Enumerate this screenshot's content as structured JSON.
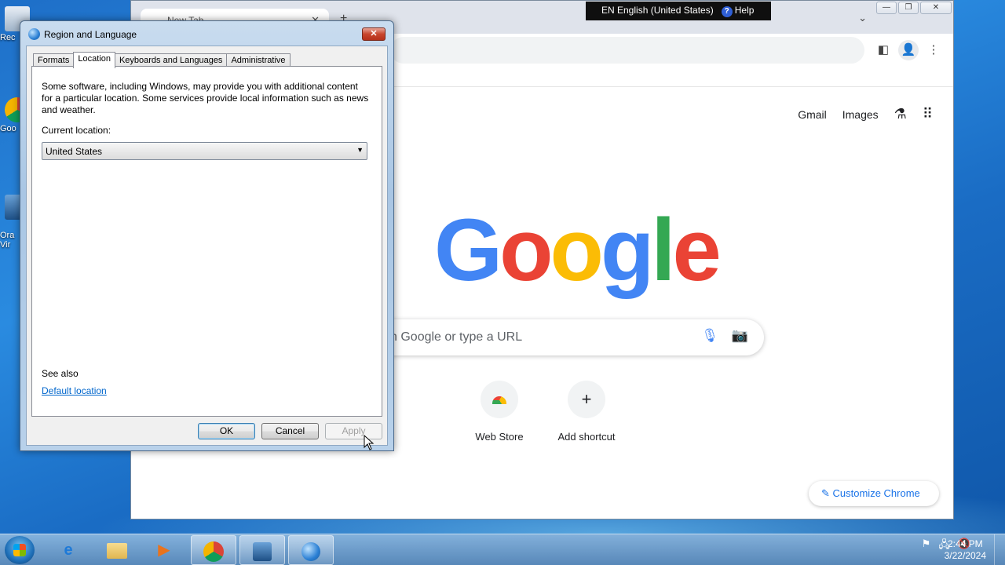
{
  "desktop": {
    "icons": [
      {
        "label": "Rec",
        "icon": "recycle-bin-icon"
      },
      {
        "label": "Goo",
        "icon": "chrome-icon"
      },
      {
        "label": "Ora\nVir",
        "icon": "virtualbox-icon"
      }
    ]
  },
  "language_bar": {
    "language": "EN English (United States)",
    "help": "Help"
  },
  "chrome": {
    "tab_title": "New Tab",
    "omnibox_placeholder": "",
    "links": {
      "gmail": "Gmail",
      "images": "Images"
    },
    "logo": "Google",
    "search_placeholder": "Search Google or type a URL",
    "search_visible_text": "h Google or type a URL",
    "shortcuts": [
      {
        "label": "Web Store"
      },
      {
        "label": "Add shortcut",
        "glyph": "+"
      }
    ],
    "customize_label": "Customize Chrome"
  },
  "dialog": {
    "title": "Region and Language",
    "tabs": [
      {
        "label": "Formats",
        "active": false
      },
      {
        "label": "Location",
        "active": true
      },
      {
        "label": "Keyboards and Languages",
        "active": false
      },
      {
        "label": "Administrative",
        "active": false
      }
    ],
    "description": "Some software, including Windows, may provide you with additional content for a particular location. Some services provide local information such as news and weather.",
    "current_location_label": "Current location:",
    "current_location_value": "United States",
    "see_also_label": "See also",
    "default_location_link": "Default location",
    "buttons": {
      "ok": "OK",
      "cancel": "Cancel",
      "apply": "Apply"
    }
  },
  "taskbar": {
    "time": "2:44 PM",
    "date": "3/22/2024"
  }
}
